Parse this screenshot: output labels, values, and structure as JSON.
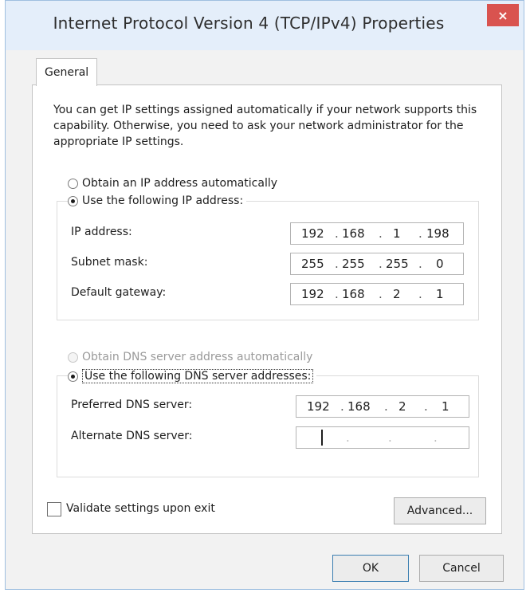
{
  "window": {
    "title": "Internet Protocol Version 4 (TCP/IPv4) Properties",
    "close_glyph": "×"
  },
  "tabs": [
    {
      "label": "General",
      "active": true
    }
  ],
  "general": {
    "description": "You can get IP settings assigned automatically if your network supports this capability. Otherwise, you need to ask your network administrator for the appropriate IP settings.",
    "ip_mode": {
      "auto_label": "Obtain an IP address automatically",
      "manual_label": "Use the following IP address:",
      "selected": "manual"
    },
    "ip_fields": [
      {
        "label": "IP address:",
        "octets": [
          "192",
          "168",
          "1",
          "198"
        ]
      },
      {
        "label": "Subnet mask:",
        "octets": [
          "255",
          "255",
          "255",
          "0"
        ]
      },
      {
        "label": "Default gateway:",
        "octets": [
          "192",
          "168",
          "2",
          "1"
        ]
      }
    ],
    "dns_mode": {
      "auto_label": "Obtain DNS server address automatically",
      "auto_enabled": false,
      "manual_label": "Use the following DNS server addresses:",
      "selected": "manual"
    },
    "dns_fields": [
      {
        "label": "Preferred DNS server:",
        "octets": [
          "192",
          "168",
          "2",
          "1"
        ]
      },
      {
        "label": "Alternate DNS server:",
        "octets": [
          "",
          "",
          "",
          ""
        ]
      }
    ],
    "validate": {
      "label": "Validate settings upon exit",
      "checked": false
    },
    "advanced_label": "Advanced..."
  },
  "footer": {
    "ok_label": "OK",
    "cancel_label": "Cancel"
  },
  "colors": {
    "close_button": "#d9534f",
    "title_bar": "#e4eefa",
    "focus_border": "#3c7fb1"
  }
}
